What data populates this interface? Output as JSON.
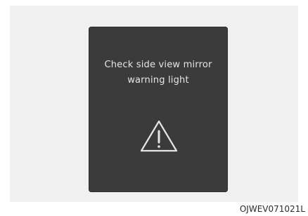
{
  "display": {
    "message_line1": "Check side view mirror",
    "message_line2": "warning light",
    "icon": "warning-triangle-icon"
  },
  "figure_code": "OJWEV071021L",
  "colors": {
    "panel_bg": "#3b3b3b",
    "text": "#e6e6e6",
    "stage_bg": "#f0f0f0"
  }
}
